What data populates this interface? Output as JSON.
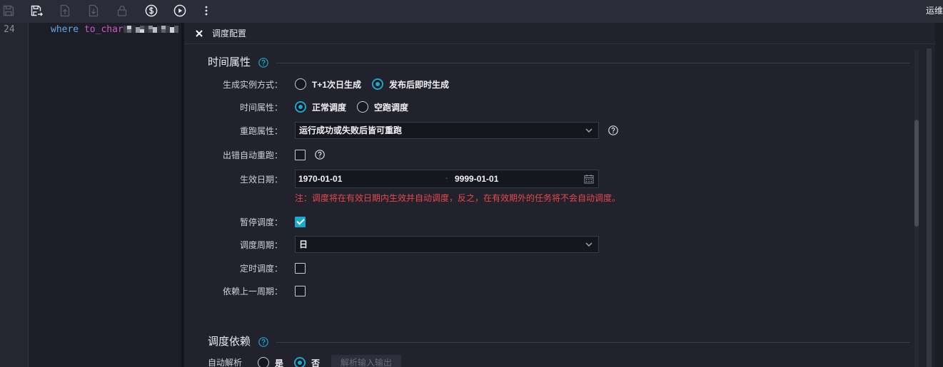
{
  "toolbar": {
    "icons": [
      "save-icon",
      "save-as-icon",
      "upload-icon",
      "download-icon",
      "lock-icon",
      "dollar-circle-icon",
      "play-circle-icon",
      "more-vertical-icon"
    ],
    "right_label": "运维"
  },
  "editor": {
    "line_number": "24",
    "keyword": "where",
    "function": "to_char"
  },
  "panel": {
    "title": "调度配置",
    "time_section": {
      "title": "时间属性",
      "instance_mode": {
        "label": "生成实例方式：",
        "options": [
          "T+1次日生成",
          "发布后即时生成"
        ],
        "selected_index": 1
      },
      "time_attribute": {
        "label": "时间属性：",
        "options": [
          "正常调度",
          "空跑调度"
        ],
        "selected_index": 0
      },
      "rerun": {
        "label": "重跑属性：",
        "value": "运行成功或失败后皆可重跑"
      },
      "auto_rerun_on_error": {
        "label": "出错自动重跑：",
        "checked": false
      },
      "effective_date": {
        "label": "生效日期：",
        "start": "1970-01-01",
        "separator": "-",
        "end": "9999-01-01",
        "note": "注：调度将在有效日期内生效并自动调度，反之，在有效期外的任务将不会自动调度。"
      },
      "pause_schedule": {
        "label": "暂停调度：",
        "checked": true
      },
      "schedule_cycle": {
        "label": "调度周期：",
        "value": "日"
      },
      "timed_schedule": {
        "label": "定时调度：",
        "checked": false
      },
      "depend_on_previous_cycle": {
        "label": "依赖上一周期：",
        "checked": false
      }
    },
    "dependency_section": {
      "title": "调度依赖",
      "auto_parse": {
        "label": "自动解析",
        "options": [
          "是",
          "否"
        ],
        "selected_index": 1,
        "button_label": "解析输入输出",
        "button_disabled": true
      }
    }
  },
  "colors": {
    "accent": "#1ba8cc",
    "note_red": "#e5484d",
    "toolbar_bg": "#2b2c37",
    "panel_bg": "#21222c"
  }
}
